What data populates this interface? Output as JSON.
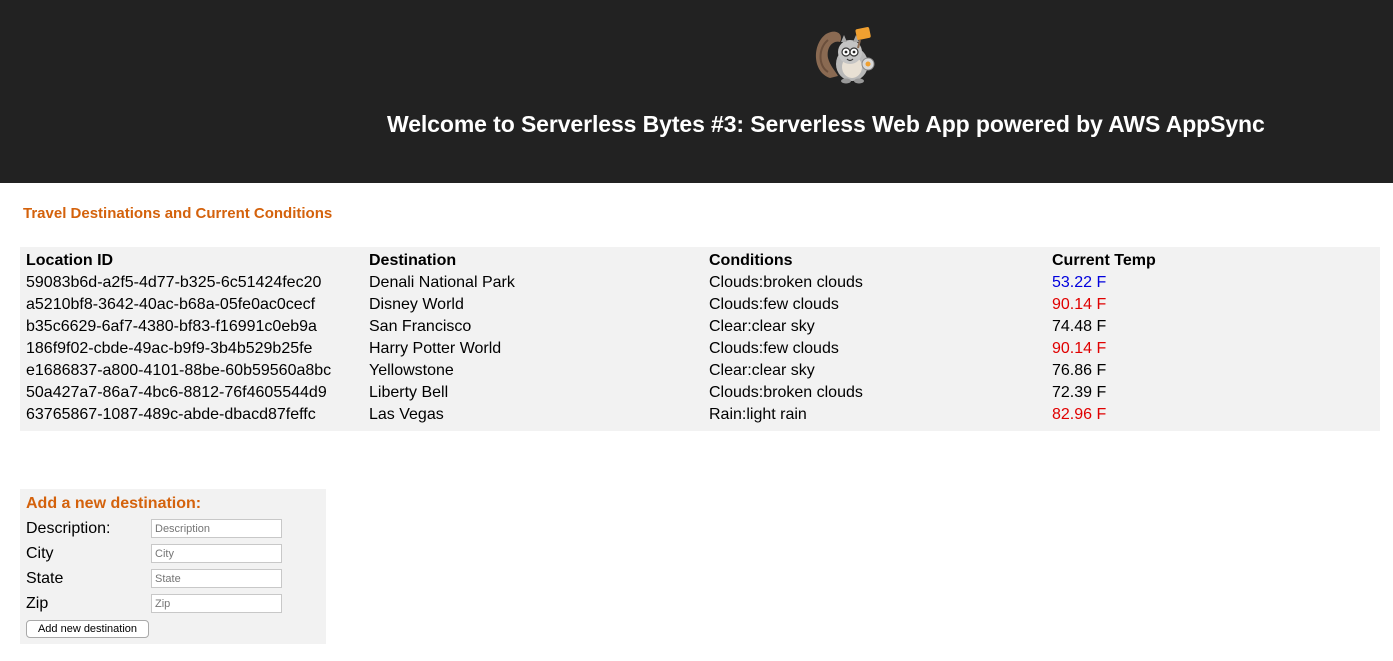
{
  "header": {
    "title": "Welcome to Serverless Bytes #3: Serverless Web App powered by AWS AppSync",
    "logo_icon": "squirrel-mascot-logo-icon"
  },
  "section": {
    "title": "Travel Destinations and Current Conditions"
  },
  "table": {
    "columns": [
      "Location ID",
      "Destination",
      "Conditions",
      "Current Temp"
    ],
    "rows": [
      {
        "id": "59083b6d-a2f5-4d77-b325-6c51424fec20",
        "destination": "Denali National Park",
        "conditions": "Clouds:broken clouds",
        "temp": "53.22 F",
        "temp_color": "#0000dd"
      },
      {
        "id": "a5210bf8-3642-40ac-b68a-05fe0ac0cecf",
        "destination": "Disney World",
        "conditions": "Clouds:few clouds",
        "temp": "90.14 F",
        "temp_color": "#e00000"
      },
      {
        "id": "b35c6629-6af7-4380-bf83-f16991c0eb9a",
        "destination": "San Francisco",
        "conditions": "Clear:clear sky",
        "temp": "74.48 F",
        "temp_color": "#000000"
      },
      {
        "id": "186f9f02-cbde-49ac-b9f9-3b4b529b25fe",
        "destination": "Harry Potter World",
        "conditions": "Clouds:few clouds",
        "temp": "90.14 F",
        "temp_color": "#e00000"
      },
      {
        "id": "e1686837-a800-4101-88be-60b59560a8bc",
        "destination": "Yellowstone",
        "conditions": "Clear:clear sky",
        "temp": "76.86 F",
        "temp_color": "#000000"
      },
      {
        "id": "50a427a7-86a7-4bc6-8812-76f4605544d9",
        "destination": "Liberty Bell",
        "conditions": "Clouds:broken clouds",
        "temp": "72.39 F",
        "temp_color": "#000000"
      },
      {
        "id": "63765867-1087-489c-abde-dbacd87feffc",
        "destination": "Las Vegas",
        "conditions": "Rain:light rain",
        "temp": "82.96 F",
        "temp_color": "#e00000"
      }
    ]
  },
  "form": {
    "title": "Add a new destination:",
    "fields": [
      {
        "label": "Description:",
        "placeholder": "Description",
        "value": ""
      },
      {
        "label": "City",
        "placeholder": "City",
        "value": ""
      },
      {
        "label": "State",
        "placeholder": "State",
        "value": ""
      },
      {
        "label": "Zip",
        "placeholder": "Zip",
        "value": ""
      }
    ],
    "submit_label": "Add new destination"
  },
  "colors": {
    "header_bg": "#222222",
    "accent": "#d4620c",
    "panel_bg": "#f2f2f2",
    "temp_cold": "#0000dd",
    "temp_hot": "#e00000"
  }
}
